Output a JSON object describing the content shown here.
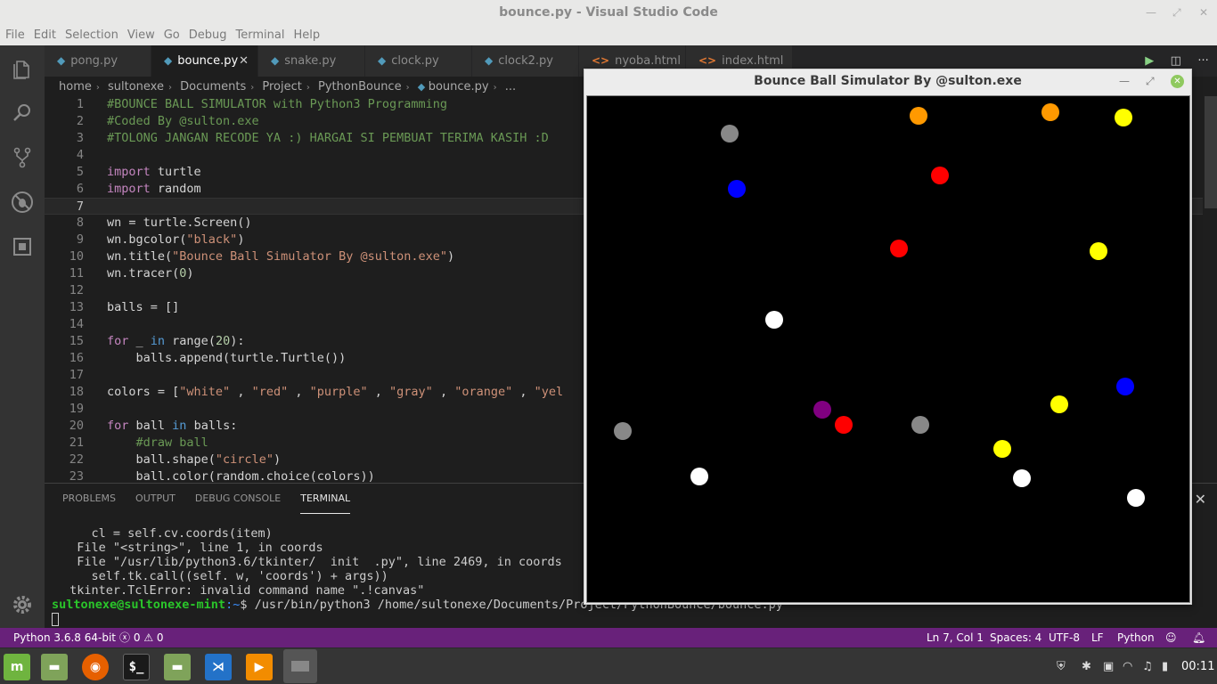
{
  "window": {
    "title": "bounce.py - Visual Studio Code"
  },
  "menu": [
    "File",
    "Edit",
    "Selection",
    "View",
    "Go",
    "Debug",
    "Terminal",
    "Help"
  ],
  "tabs": [
    {
      "label": "pong.py",
      "type": "py"
    },
    {
      "label": "bounce.py",
      "type": "py",
      "active": true
    },
    {
      "label": "snake.py",
      "type": "py"
    },
    {
      "label": "clock.py",
      "type": "py"
    },
    {
      "label": "clock2.py",
      "type": "py"
    },
    {
      "label": "nyoba.html",
      "type": "html"
    },
    {
      "label": "index.html",
      "type": "html"
    }
  ],
  "breadcrumb": [
    "home",
    "sultonexe",
    "Documents",
    "Project",
    "PythonBounce",
    "bounce.py",
    "..."
  ],
  "code": [
    {
      "n": "1",
      "text": "#BOUNCE BALL SIMULATOR with Python3 Programming"
    },
    {
      "n": "2",
      "text": "#Coded By @sulton.exe"
    },
    {
      "n": "3",
      "text": "#TOLONG JANGAN RECODE YA :) HARGAI SI PEMBUAT TERIMA KASIH :D"
    },
    {
      "n": "4",
      "text": ""
    },
    {
      "n": "5",
      "text": "import turtle"
    },
    {
      "n": "6",
      "text": "import random"
    },
    {
      "n": "7",
      "text": ""
    },
    {
      "n": "8",
      "text": "wn = turtle.Screen()"
    },
    {
      "n": "9",
      "text": "wn.bgcolor(\"black\")"
    },
    {
      "n": "10",
      "text": "wn.title(\"Bounce Ball Simulator By @sulton.exe\")"
    },
    {
      "n": "11",
      "text": "wn.tracer(0)"
    },
    {
      "n": "12",
      "text": ""
    },
    {
      "n": "13",
      "text": "balls = []"
    },
    {
      "n": "14",
      "text": ""
    },
    {
      "n": "15",
      "text": "for _ in range(20):"
    },
    {
      "n": "16",
      "text": "    balls.append(turtle.Turtle())"
    },
    {
      "n": "17",
      "text": ""
    },
    {
      "n": "18",
      "text": "colors = [\"white\" , \"red\" , \"purple\" , \"gray\" , \"orange\" , \"yel"
    },
    {
      "n": "19",
      "text": ""
    },
    {
      "n": "20",
      "text": "for ball in balls:"
    },
    {
      "n": "21",
      "text": "    #draw ball"
    },
    {
      "n": "22",
      "text": "    ball.shape(\"circle\")"
    },
    {
      "n": "23",
      "text": "    ball.color(random.choice(colors))"
    }
  ],
  "panel": {
    "tabs": [
      "PROBLEMS",
      "OUTPUT",
      "DEBUG CONSOLE",
      "TERMINAL"
    ],
    "active_tab": "TERMINAL",
    "terminal_lines": [
      "    cl = self.cv.coords(item)",
      "  File \"<string>\", line 1, in coords",
      "  File \"/usr/lib/python3.6/tkinter/  init  .py\", line 2469, in coords",
      "    self.tk.call((self. w, 'coords') + args))",
      " tkinter.TclError: invalid command name \".!canvas\""
    ],
    "prompt_user": "sultonexe@sultonexe-mint",
    "prompt_path": ":~",
    "prompt_cmd": "$ /usr/bin/python3 /home/sultonexe/Documents/Project/PythonBounce/bounce.py"
  },
  "status": {
    "python": "Python 3.6.8 64-bit",
    "errors": "0",
    "warnings": "0",
    "position": "Ln 7, Col 1",
    "spaces": "Spaces: 4",
    "encoding": "UTF-8",
    "eol": "LF",
    "language": "Python"
  },
  "turtle_window": {
    "title": "Bounce Ball Simulator By @sulton.exe",
    "balls": [
      {
        "color": "#888888"
      },
      {
        "color": "#ff9900"
      },
      {
        "color": "#ff9900"
      },
      {
        "color": "#ffff00"
      },
      {
        "color": "#0000ff"
      },
      {
        "color": "#ff0000"
      },
      {
        "color": "#ff0000"
      },
      {
        "color": "#ffff00"
      },
      {
        "color": "#ffffff"
      },
      {
        "color": "#0000ff"
      },
      {
        "color": "#ffff00"
      },
      {
        "color": "#800080"
      },
      {
        "color": "#ff0000"
      },
      {
        "color": "#888888"
      },
      {
        "color": "#888888"
      },
      {
        "color": "#ffff00"
      },
      {
        "color": "#ffffff"
      },
      {
        "color": "#ffffff"
      },
      {
        "color": "#ffffff"
      }
    ]
  },
  "taskbar": {
    "clock": "00:11"
  }
}
